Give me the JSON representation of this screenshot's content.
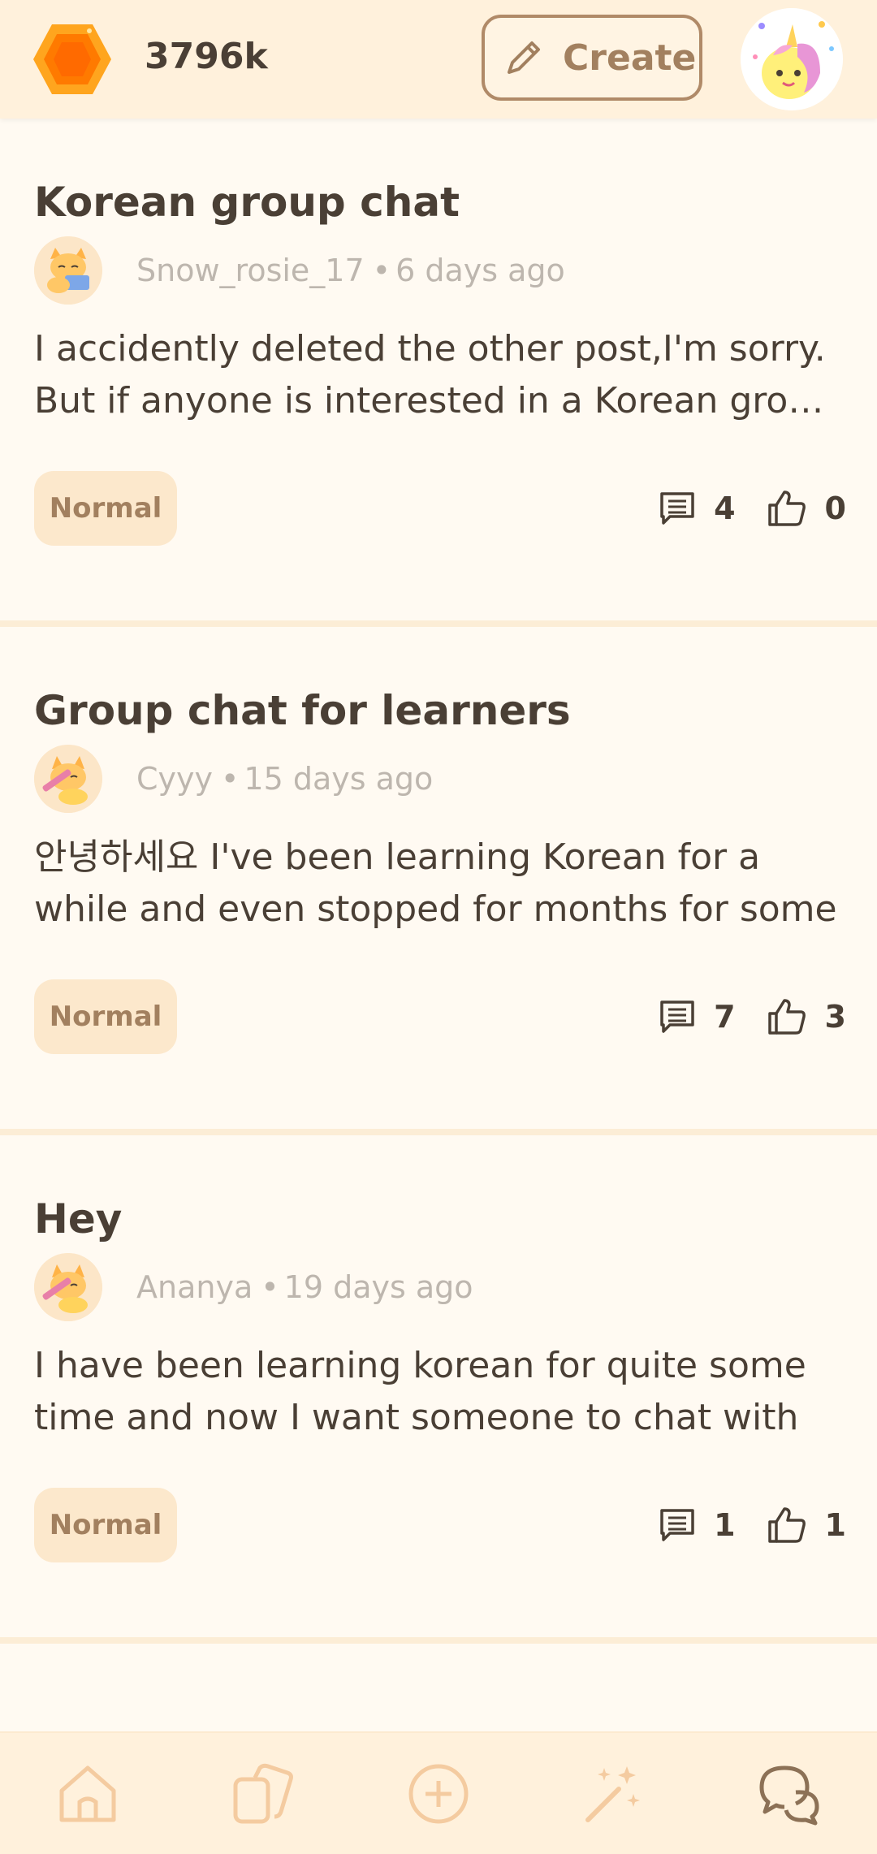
{
  "header": {
    "points": "3796k",
    "create_label": "Create",
    "gem_icon": "orange-gem-icon",
    "avatar_icon": "unicorn-avatar"
  },
  "posts": [
    {
      "title": "Korean group chat",
      "author": "Snow_rosie_17",
      "time": "6 days ago",
      "body": "I accidently deleted the other post,I'm sorry. But if anyone is interested in a Korean group chat",
      "tag": "Normal",
      "comments": "4",
      "likes": "0"
    },
    {
      "title": "Group chat for learners",
      "author": "Cyyy",
      "time": "15 days ago",
      "body": "안녕하세요 I've been learning Korean for a while and even stopped for months for some",
      "tag": "Normal",
      "comments": "7",
      "likes": "3"
    },
    {
      "title": "Hey",
      "author": "Ananya",
      "time": "19 days ago",
      "body": "I have been learning korean for quite some time and now I want someone to chat with",
      "tag": "Normal",
      "comments": "1",
      "likes": "1"
    }
  ],
  "separator": "•",
  "bottom_nav": [
    "home-icon",
    "cards-icon",
    "add-circle-icon",
    "magic-wand-icon",
    "chat-bubbles-icon"
  ],
  "colors": {
    "header_bg": "#FFF1DC",
    "page_bg": "#FFFAF2",
    "accent_brown": "#A2805F",
    "tag_bg": "#FCE8CC",
    "gem": "#FF8A00"
  }
}
